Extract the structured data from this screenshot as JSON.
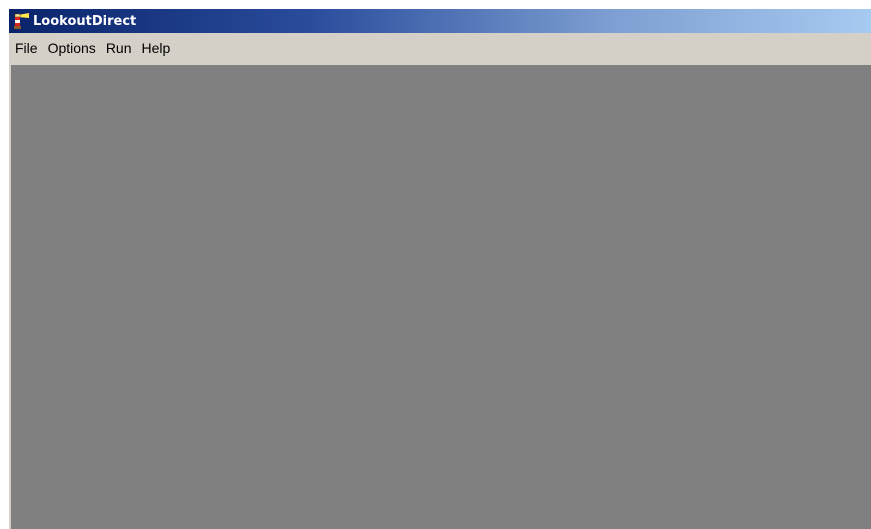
{
  "window": {
    "title": "LookoutDirect",
    "icon": "lighthouse-icon"
  },
  "menubar": {
    "items": [
      {
        "label": "File"
      },
      {
        "label": "Options"
      },
      {
        "label": "Run"
      },
      {
        "label": "Help"
      }
    ]
  },
  "colors": {
    "titlebar_start": "#0a246a",
    "titlebar_end": "#a6caf0",
    "menubar_bg": "#d4d0c8",
    "client_bg": "#808080"
  }
}
